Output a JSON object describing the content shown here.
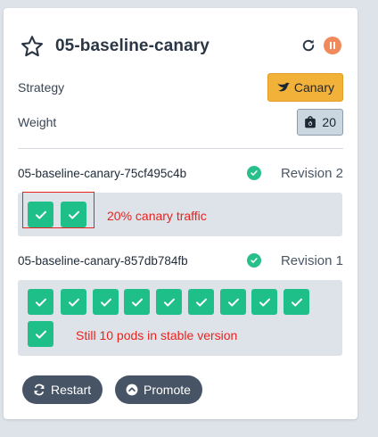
{
  "card": {
    "title": "05-baseline-canary",
    "title_icon": "star-icon",
    "actions": [
      "refresh-icon",
      "pause-icon"
    ],
    "accent_color": "#f08a5d"
  },
  "properties": {
    "strategy_label": "Strategy",
    "strategy_value": "Canary",
    "strategy_icon": "dove-icon",
    "strategy_color": "#f2b23a",
    "weight_label": "Weight",
    "weight_value": "20",
    "weight_icon": "weight-icon"
  },
  "revisions": [
    {
      "replicaset": "05-baseline-canary-75cf495c4b",
      "revision": "Revision 2",
      "status": "healthy",
      "pod_count": 2,
      "annotation": "20% canary traffic"
    },
    {
      "replicaset": "05-baseline-canary-857db784fb",
      "revision": "Revision 1",
      "status": "healthy",
      "pod_count": 10,
      "annotation": "Still 10 pods in stable version"
    }
  ],
  "footer": {
    "restart_label": "Restart",
    "promote_label": "Promote"
  },
  "colors": {
    "pod_healthy": "#1fbf8a",
    "annotation": "#e8231e"
  }
}
